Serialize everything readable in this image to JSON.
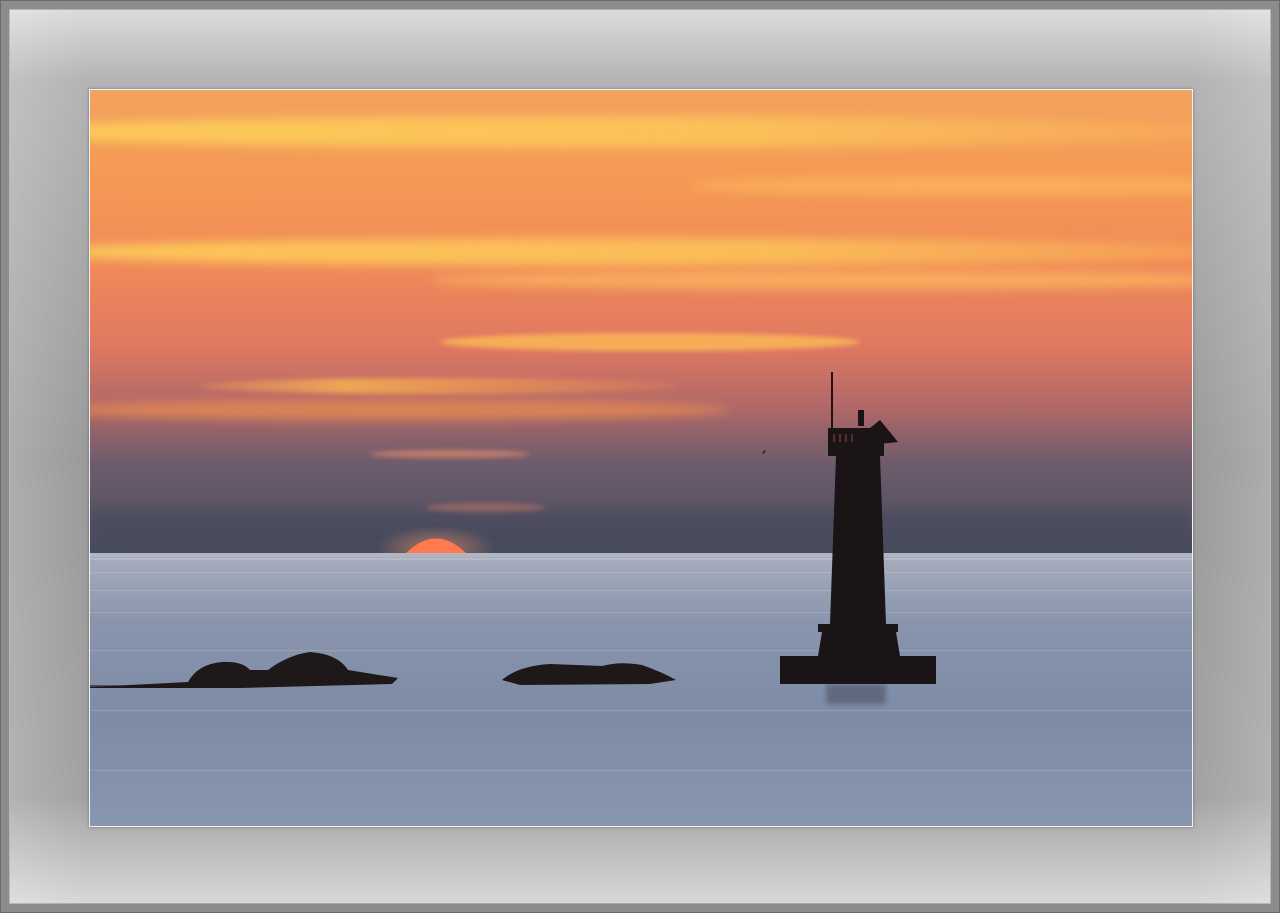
{
  "scene": {
    "subject": "lighthouse-at-sunset",
    "colors": {
      "frame": "#9b9b9b",
      "sky_top": "#f4a55a",
      "sky_mid": "#e8845a",
      "sky_low": "#5b5668",
      "horizon_haze": "#4a4e5e",
      "sun": "#ff7a4e",
      "sea": "#8e9cb4",
      "silhouette": "#1b1416"
    }
  }
}
